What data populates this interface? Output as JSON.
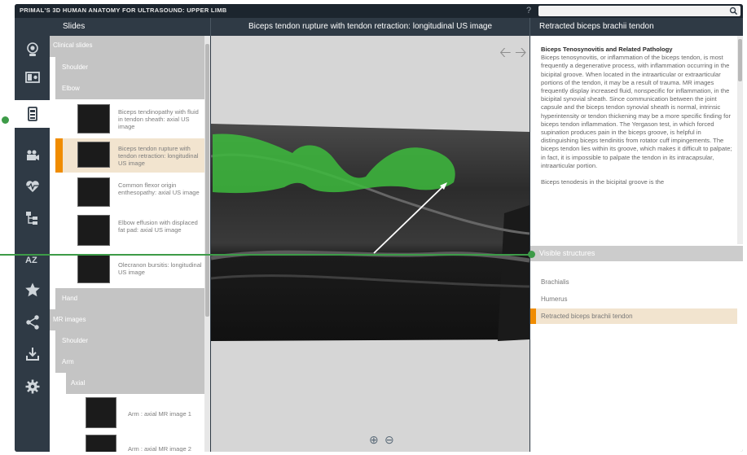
{
  "app": {
    "title": "PRIMAL'S 3D HUMAN ANATOMY FOR ULTRASOUND: UPPER LIMB",
    "help": "?",
    "search_placeholder": ""
  },
  "headers": {
    "slides": "Slides",
    "viewer": "Biceps tendon rupture with tendon retraction: longitudinal US image",
    "info": "Retracted biceps brachii tendon"
  },
  "rail": {
    "icons": [
      "skull-icon",
      "split-view-icon",
      "slides-icon",
      "video-icon",
      "heartbeat-icon",
      "hierarchy-icon",
      "az-icon",
      "star-icon",
      "share-icon",
      "download-icon",
      "settings-icon"
    ],
    "active_index": 2
  },
  "slides": {
    "clinical": "Clinical slides",
    "shoulder": "Shoulder",
    "elbow": "Elbow",
    "items": [
      "Biceps tendinopathy with fluid in tendon sheath: axial US image",
      "Biceps tendon rupture with tendon retraction: longitudinal US image",
      "Common flexor origin enthesopathy: axial US image",
      "Elbow effusion with displaced fat pad: axial US image",
      "Olecranon bursitis: longitudinal US image"
    ],
    "hand": "Hand",
    "mr_images": "MR images",
    "mr_shoulder": "Shoulder",
    "mr_arm": "Arm",
    "mr_axial": "Axial",
    "mr_items": [
      "Arm : axial MR image 1",
      "Arm : axial MR image 2"
    ]
  },
  "description": {
    "title": "Biceps Tenosynovitis and Related Pathology",
    "para1": "Biceps tenosynovitis, or inflammation of the biceps tendon, is most frequently a degenerative process, with inflammation occurring in the bicipital groove. When located in the intraarticular or extraarticular portions of the tendon, it may be a result of trauma. MR images frequently display increased fluid, nonspecific for inflammation, in the bicipital synovial sheath. Since communication between the joint capsule and the biceps tendon synovial sheath is normal, intrinsic hyperintensity or tendon thickening may be a more specific finding for biceps tendon inflammation. The Yergason test, in which forced supination produces pain in the biceps groove, is helpful in distinguishing biceps tendinitis from rotator cuff impingements. The biceps tendon lies within its groove, which makes it difficult to palpate; in fact, it is impossible to palpate the tendon in its intracapsular, intraarticular portion.",
    "para2": "Biceps tenodesis in the bicipital groove is the"
  },
  "visible_structures": {
    "header": "Visible structures",
    "items": [
      "Brachialis",
      "Humerus",
      "Retracted biceps brachii tendon"
    ],
    "selected_index": 2
  },
  "colors": {
    "accent": "#f08c00",
    "highlight": "#3d9b48",
    "selection": "#f2e4cf",
    "chrome": "#2f3a45"
  }
}
